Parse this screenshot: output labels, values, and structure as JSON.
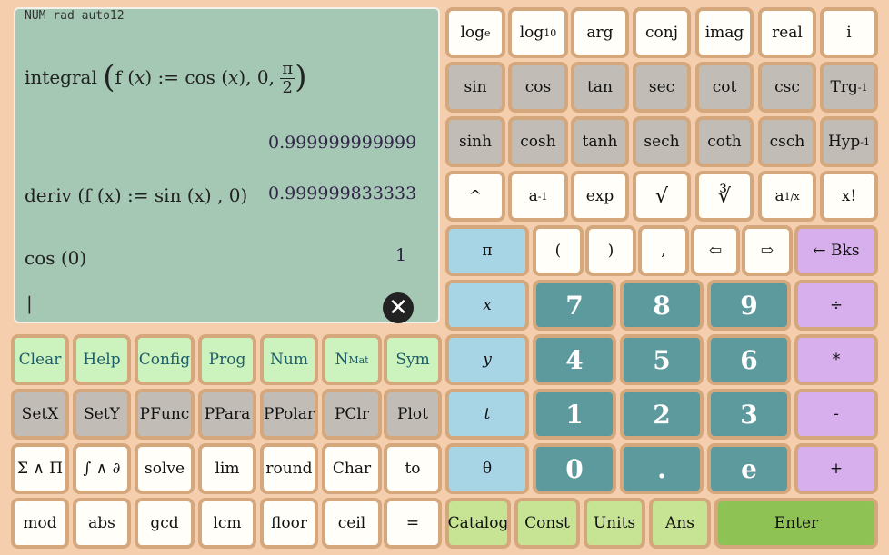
{
  "screen": {
    "status": "NUM rad auto12",
    "entries": [
      {
        "input_prefix": "integral",
        "input_f": "f",
        "input_x": "x",
        "input_func": "cos",
        "input_rest": ", 0,",
        "frac_num": "π",
        "frac_den": "2",
        "result": "0.999999999999"
      },
      {
        "input": "deriv (f (x) := sin (x) , 0)",
        "result": "0.999999833333"
      },
      {
        "input": "cos (0)",
        "result": "1"
      }
    ],
    "cursor": "|"
  },
  "keys_top": {
    "row1": [
      "log",
      "log",
      "arg",
      "conj",
      "imag",
      "real",
      "i"
    ],
    "row1_subs": [
      "e",
      "10"
    ],
    "row2": [
      "sin",
      "cos",
      "tan",
      "sec",
      "cot",
      "csc",
      "Trg"
    ],
    "row3": [
      "sinh",
      "cosh",
      "tanh",
      "sech",
      "coth",
      "csch",
      "Hyp"
    ],
    "sup_inv": "-1",
    "row4": [
      "^",
      "a",
      "exp",
      "√",
      "∛",
      "a",
      "x!"
    ],
    "row4_sups": [
      "-1",
      "1/x"
    ],
    "row5": [
      "π",
      "(",
      ")",
      ",",
      "⇦",
      "⇨",
      "← Bks"
    ]
  },
  "keys_left": {
    "row1": [
      "Clear",
      "Help",
      "Config",
      "Prog",
      "Num",
      "N",
      "Sym"
    ],
    "nmat_sub": "Mat",
    "row2": [
      "SetX",
      "SetY",
      "PFunc",
      "PPara",
      "PPolar",
      "PClr",
      "Plot"
    ],
    "row3": [
      "Σ ∧ Π",
      "∫ ∧ ∂",
      "solve",
      "lim",
      "round",
      "Char",
      "to"
    ],
    "row4": [
      "mod",
      "abs",
      "gcd",
      "lcm",
      "floor",
      "ceil",
      "="
    ]
  },
  "keys_pad": {
    "vars": [
      "x",
      "y",
      "t",
      "θ"
    ],
    "digits": [
      [
        "7",
        "8",
        "9"
      ],
      [
        "4",
        "5",
        "6"
      ],
      [
        "1",
        "2",
        "3"
      ],
      [
        "0",
        ".",
        "e"
      ]
    ],
    "ops": [
      "÷",
      "*",
      "-",
      "+"
    ],
    "bottom": [
      "Catalog",
      "Const",
      "Units",
      "Ans",
      "Enter"
    ]
  },
  "colors": {
    "background": "#f5cfad",
    "screen": "#a5c8b5",
    "digit": "#5d9a9e",
    "operator": "#d6afec",
    "variable": "#a8d5e6",
    "mode": "#ccf3bd",
    "enter": "#8fc255"
  }
}
